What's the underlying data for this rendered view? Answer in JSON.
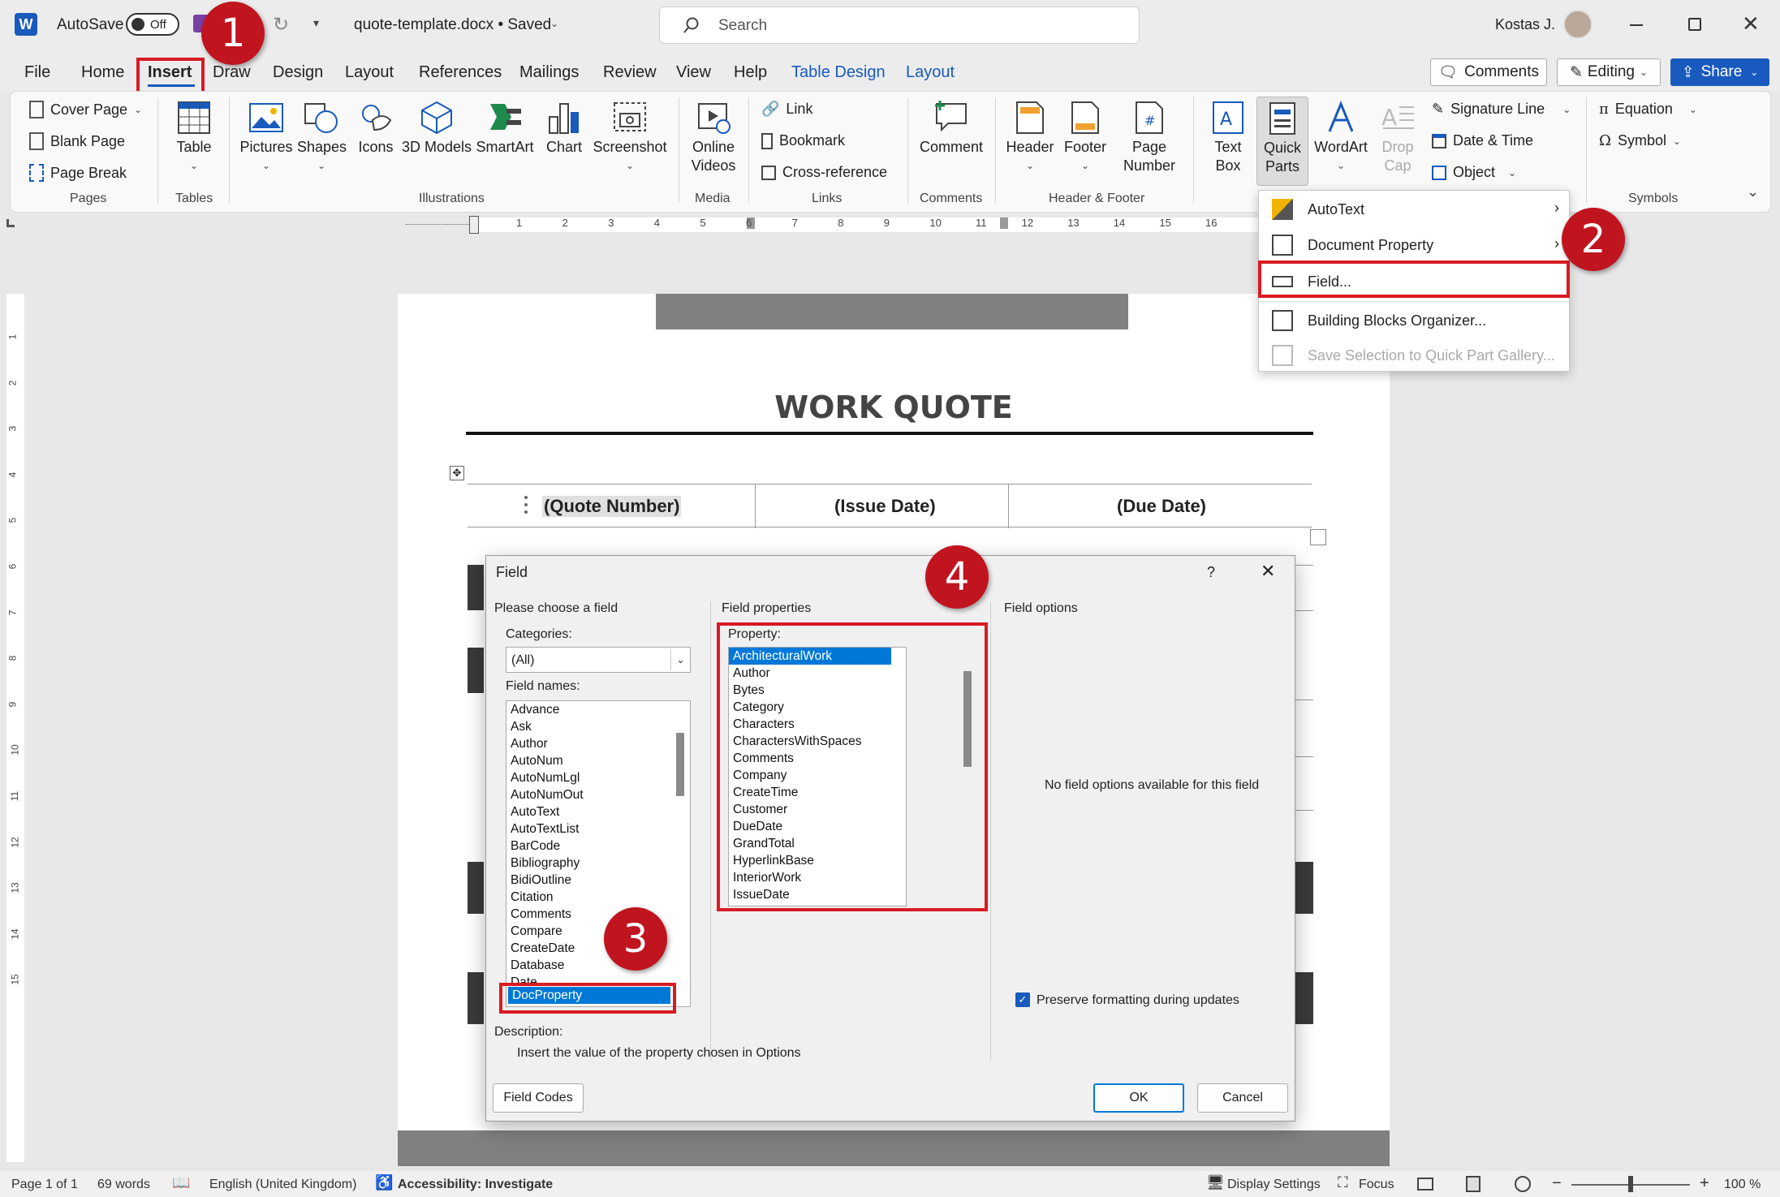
{
  "titlebar": {
    "autosave": "AutoSave",
    "toggle": "Off",
    "doc": "quote-template.docx • Saved",
    "search": "Search",
    "user": "Kostas J."
  },
  "tabs": [
    "File",
    "Home",
    "Insert",
    "Draw",
    "Design",
    "Layout",
    "References",
    "Mailings",
    "Review",
    "View",
    "Help",
    "Table Design",
    "Layout"
  ],
  "actions": {
    "comments": "Comments",
    "editing": "Editing",
    "share": "Share"
  },
  "ribbon": {
    "pages": {
      "cover": "Cover Page",
      "blank": "Blank Page",
      "break": "Page Break",
      "label": "Pages"
    },
    "tables": {
      "table": "Table",
      "label": "Tables"
    },
    "illustrations": {
      "pictures": "Pictures",
      "shapes": "Shapes",
      "icons": "Icons",
      "models": "3D Models",
      "smartart": "SmartArt",
      "chart": "Chart",
      "screenshot": "Screenshot",
      "label": "Illustrations"
    },
    "media": {
      "online": "Online Videos",
      "label": "Media"
    },
    "links": {
      "link": "Link",
      "bookmark": "Bookmark",
      "cross": "Cross-reference",
      "label": "Links"
    },
    "comments": {
      "comment": "Comment",
      "label": "Comments"
    },
    "hf": {
      "header": "Header",
      "footer": "Footer",
      "pagenum": "Page Number",
      "label": "Header & Footer"
    },
    "text": {
      "textbox": "Text Box",
      "quickparts": "Quick Parts",
      "wordart": "WordArt",
      "dropcap": "Drop Cap",
      "sigline": "Signature Line",
      "datetime": "Date & Time",
      "object": "Object"
    },
    "symbols": {
      "equation": "Equation",
      "symbol": "Symbol",
      "label": "Symbols"
    }
  },
  "ruler": [
    "1",
    "2",
    "3",
    "4",
    "5",
    "6",
    "7",
    "8",
    "9",
    "10",
    "11",
    "12",
    "13",
    "14",
    "15",
    "16"
  ],
  "vruler": [
    "1",
    "2",
    "3",
    "4",
    "5",
    "6",
    "7",
    "8",
    "9",
    "10",
    "11",
    "12",
    "13",
    "14",
    "15"
  ],
  "menu": {
    "autotext": "AutoText",
    "docprop": "Document Property",
    "field": "Field...",
    "bbo": "Building Blocks Organizer...",
    "save": "Save Selection to Quick Part Gallery..."
  },
  "document": {
    "title": "WORK QUOTE",
    "h1": "(Quote Number)",
    "h2": "(Issue Date)",
    "h3": "(Due Date)"
  },
  "dialog": {
    "title": "Field",
    "help": "?",
    "choose": "Please choose a field",
    "categories": "Categories:",
    "cat_value": "(All)",
    "fieldnames": "Field names:",
    "fields": [
      "Advance",
      "Ask",
      "Author",
      "AutoNum",
      "AutoNumLgl",
      "AutoNumOut",
      "AutoText",
      "AutoTextList",
      "BarCode",
      "Bibliography",
      "BidiOutline",
      "Citation",
      "Comments",
      "Compare",
      "CreateDate",
      "Database",
      "Date",
      "DocProperty"
    ],
    "selected_field": "DocProperty",
    "props_title": "Field properties",
    "property": "Property:",
    "properties": [
      "ArchitecturalWork",
      "Author",
      "Bytes",
      "Category",
      "Characters",
      "CharactersWithSpaces",
      "Comments",
      "Company",
      "CreateTime",
      "Customer",
      "DueDate",
      "GrandTotal",
      "HyperlinkBase",
      "InteriorWork",
      "IssueDate"
    ],
    "options_title": "Field options",
    "no_options": "No field options available for this field",
    "preserve": "Preserve formatting during updates",
    "desc_label": "Description:",
    "desc": "Insert the value of the property chosen in Options",
    "fieldcodes": "Field Codes",
    "ok": "OK",
    "cancel": "Cancel"
  },
  "callouts": [
    "1",
    "2",
    "3",
    "4"
  ],
  "status": {
    "page": "Page 1 of 1",
    "words": "69 words",
    "lang": "English (United Kingdom)",
    "access": "Accessibility: Investigate",
    "display": "Display Settings",
    "focus": "Focus",
    "zoom": "100 %"
  },
  "colors": {
    "accent": "#185abd",
    "callout": "#c0141f",
    "highlight": "#d81b23",
    "selection": "#0078d7"
  }
}
